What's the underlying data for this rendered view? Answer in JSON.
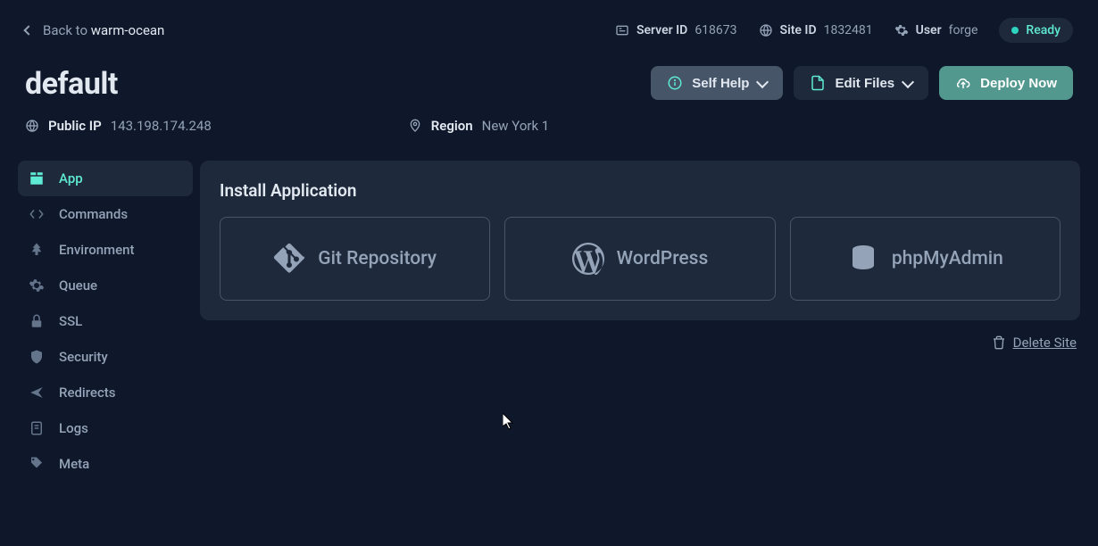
{
  "back": {
    "prefix": "Back to ",
    "target": "warm-ocean"
  },
  "topbar": {
    "server_id_label": "Server ID",
    "server_id_value": "618673",
    "site_id_label": "Site ID",
    "site_id_value": "1832481",
    "user_label": "User",
    "user_value": "forge",
    "status": "Ready"
  },
  "page": {
    "title": "default"
  },
  "actions": {
    "self_help": "Self Help",
    "edit_files": "Edit Files",
    "deploy_now": "Deploy Now"
  },
  "info": {
    "ip_label": "Public IP",
    "ip_value": "143.198.174.248",
    "region_label": "Region",
    "region_value": "New York 1"
  },
  "sidebar": {
    "items": [
      {
        "label": "App"
      },
      {
        "label": "Commands"
      },
      {
        "label": "Environment"
      },
      {
        "label": "Queue"
      },
      {
        "label": "SSL"
      },
      {
        "label": "Security"
      },
      {
        "label": "Redirects"
      },
      {
        "label": "Logs"
      },
      {
        "label": "Meta"
      }
    ]
  },
  "install": {
    "title": "Install Application",
    "options": [
      {
        "label": "Git Repository"
      },
      {
        "label": "WordPress"
      },
      {
        "label": "phpMyAdmin"
      }
    ]
  },
  "delete_label": "Delete Site"
}
